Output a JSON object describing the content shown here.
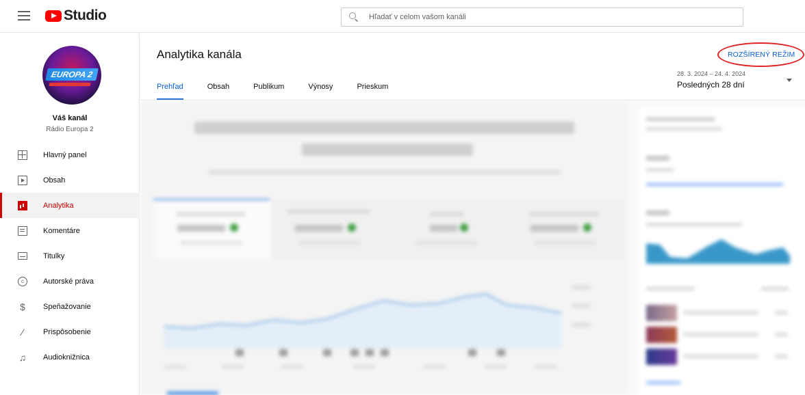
{
  "app": {
    "name": "Studio"
  },
  "search": {
    "placeholder": "Hľadať v celom vašom kanáli"
  },
  "channel": {
    "title": "Váš kanál",
    "name": "Rádio Europa 2",
    "avatar_text": "EUROPA 2"
  },
  "sidebar": {
    "items": [
      {
        "label": "Hlavný panel",
        "icon": "dashboard-icon",
        "active": false
      },
      {
        "label": "Obsah",
        "icon": "content-icon",
        "active": false
      },
      {
        "label": "Analytika",
        "icon": "analytics-icon",
        "active": true
      },
      {
        "label": "Komentáre",
        "icon": "comments-icon",
        "active": false
      },
      {
        "label": "Titulky",
        "icon": "subtitles-icon",
        "active": false
      },
      {
        "label": "Autorské práva",
        "icon": "copyright-icon",
        "active": false
      },
      {
        "label": "Speňažovanie",
        "icon": "monetization-icon",
        "active": false
      },
      {
        "label": "Prispôsobenie",
        "icon": "customization-icon",
        "active": false
      },
      {
        "label": "Audioknižnica",
        "icon": "audio-library-icon",
        "active": false
      }
    ]
  },
  "main": {
    "title": "Analytika kanála",
    "tabs": [
      {
        "label": "Prehľad",
        "active": true
      },
      {
        "label": "Obsah",
        "active": false
      },
      {
        "label": "Publikum",
        "active": false
      },
      {
        "label": "Výnosy",
        "active": false
      },
      {
        "label": "Prieskum",
        "active": false
      }
    ],
    "advanced_mode": "ROZŠÍRENÝ REŽIM",
    "date_range": "28. 3. 2024 – 24. 4. 2024",
    "date_period": "Posledných 28 dní"
  },
  "colors": {
    "accent": "#065fd4",
    "brand_red": "#ff0000",
    "active_red": "#cc0000",
    "highlight_ring": "#e02020"
  }
}
